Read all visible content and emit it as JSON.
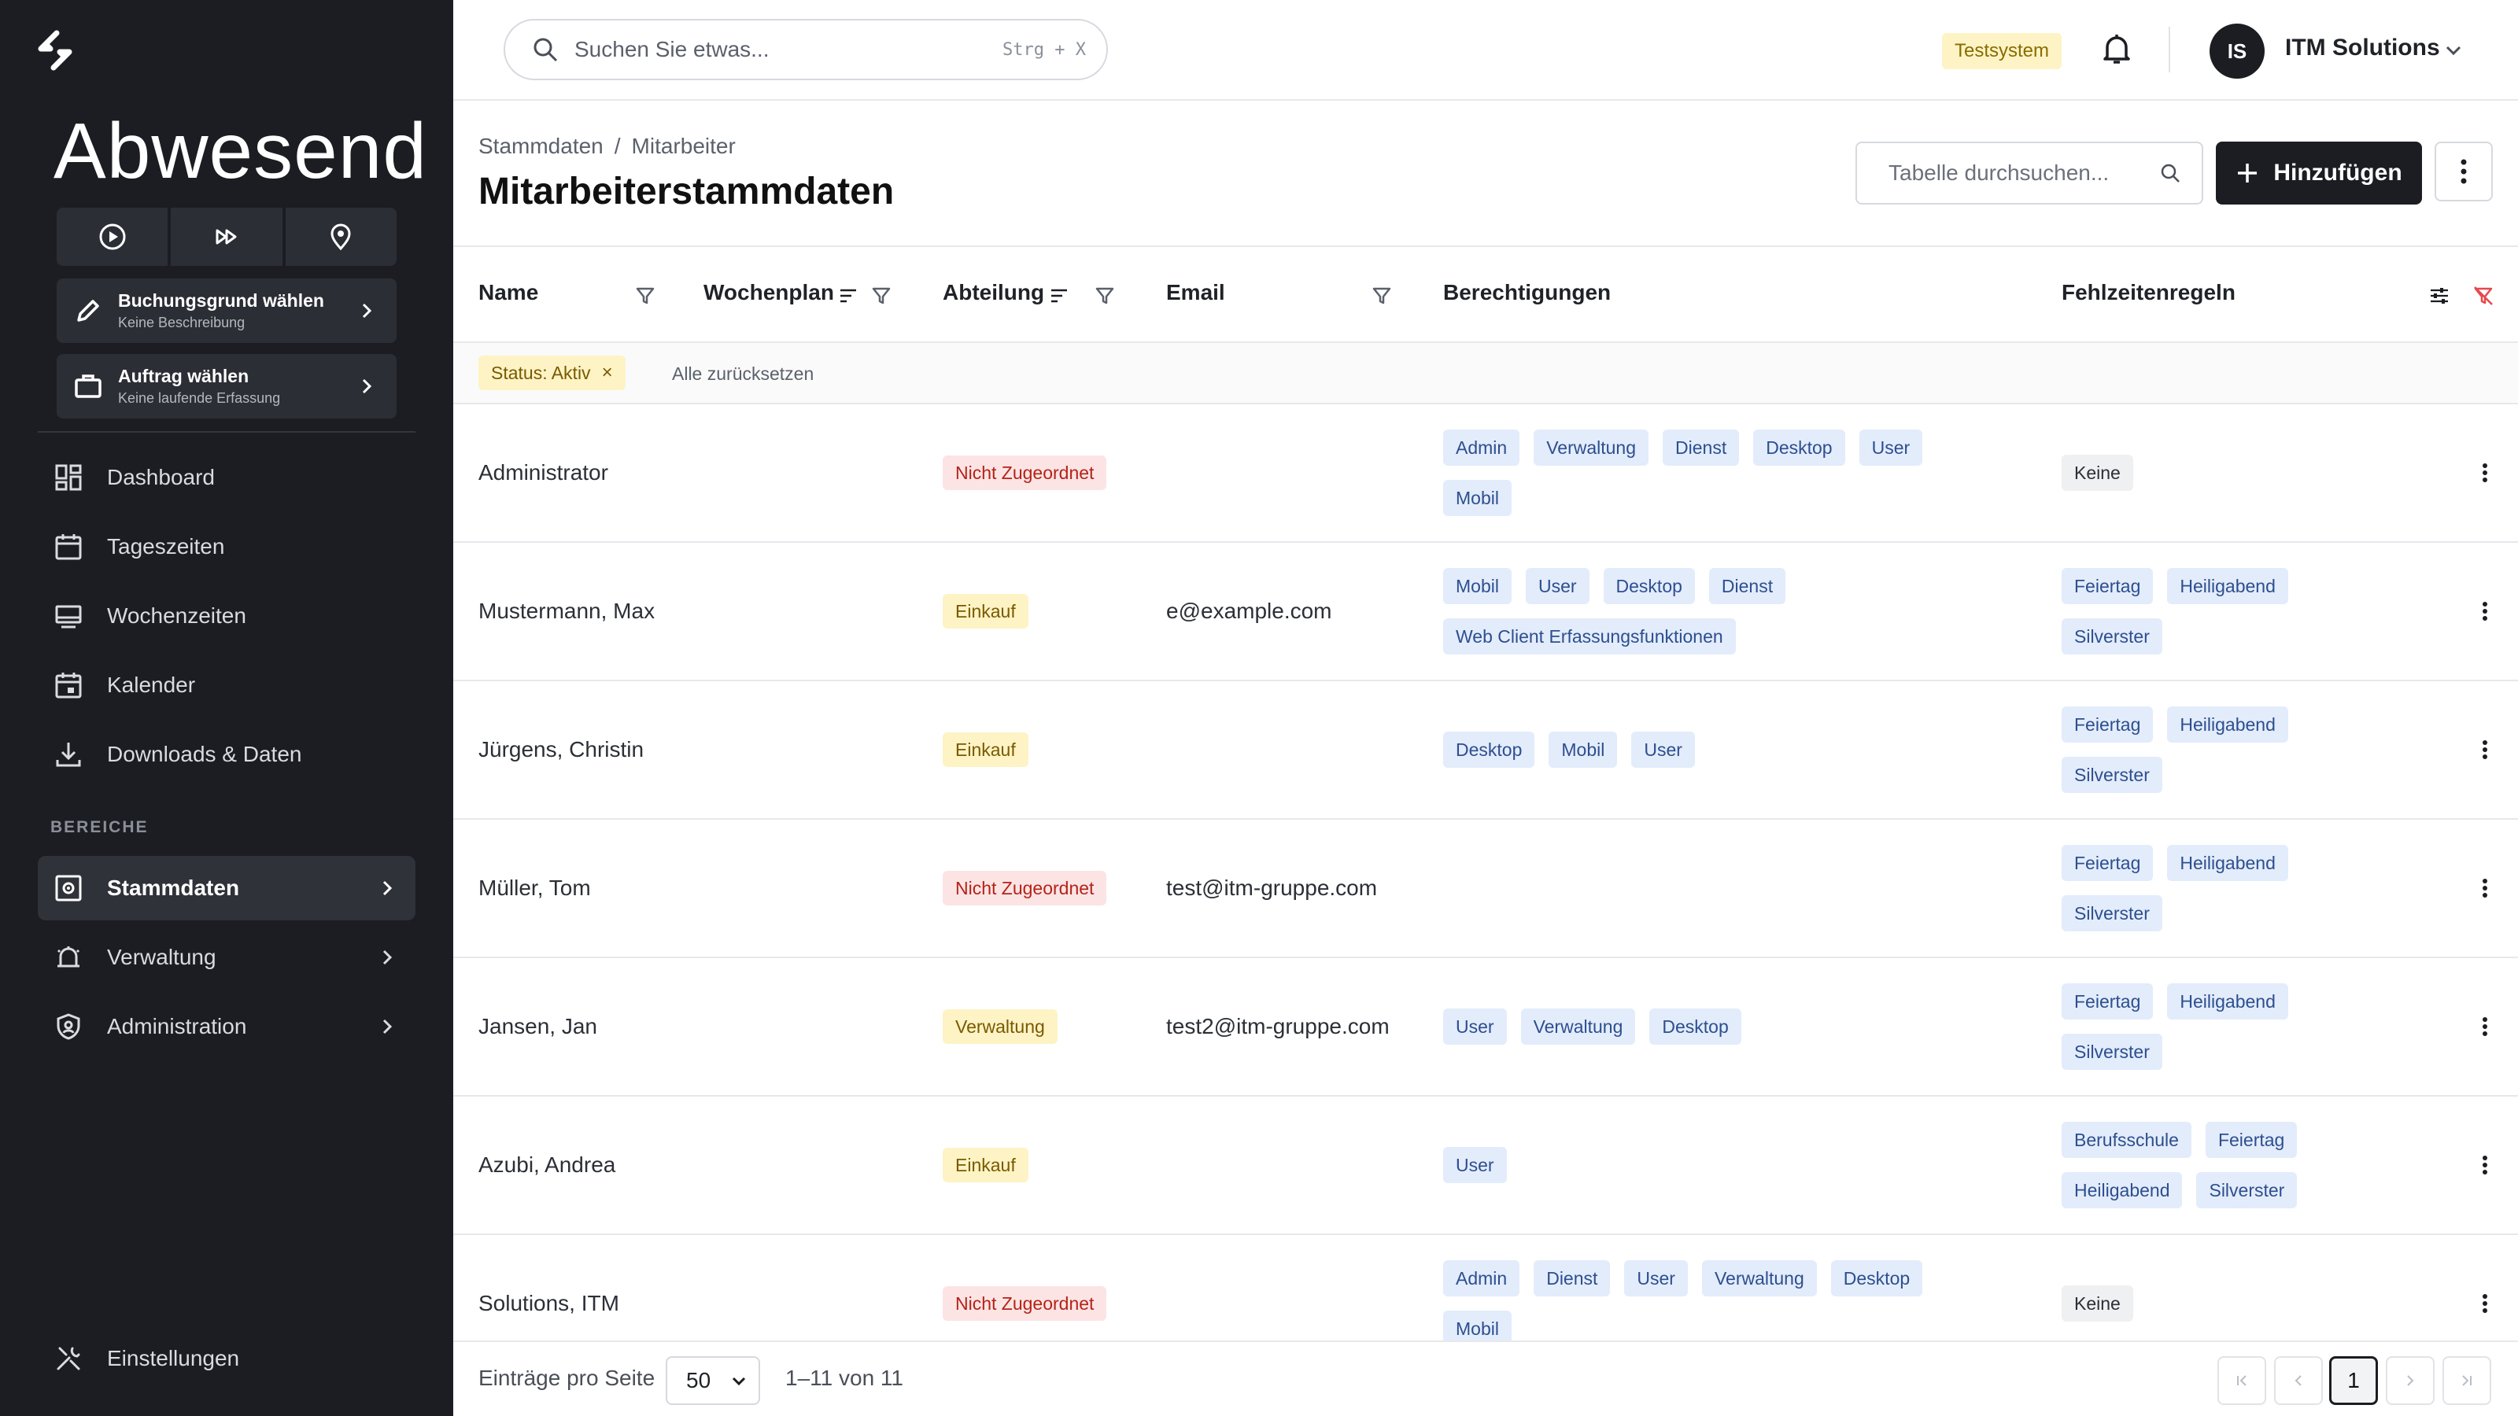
{
  "sidebar": {
    "status_title": "Abwesend",
    "controls": [
      {
        "icon": "play-circle-icon"
      },
      {
        "icon": "fast-forward-icon"
      },
      {
        "icon": "map-pin-icon"
      }
    ],
    "cards": [
      {
        "title": "Buchungsgrund wählen",
        "subtitle": "Keine Beschreibung",
        "icon": "pencil-icon"
      },
      {
        "title": "Auftrag wählen",
        "subtitle": "Keine laufende Erfassung",
        "icon": "briefcase-icon"
      }
    ],
    "nav": [
      {
        "label": "Dashboard",
        "icon": "dashboard-icon"
      },
      {
        "label": "Tageszeiten",
        "icon": "calendar-icon"
      },
      {
        "label": "Wochenzeiten",
        "icon": "monitor-icon"
      },
      {
        "label": "Kalender",
        "icon": "calendar-event-icon"
      },
      {
        "label": "Downloads & Daten",
        "icon": "download-icon"
      }
    ],
    "section_label": "BEREICHE",
    "areas": [
      {
        "label": "Stammdaten",
        "icon": "settings-box-icon",
        "active": true
      },
      {
        "label": "Verwaltung",
        "icon": "alarm-icon"
      },
      {
        "label": "Administration",
        "icon": "shield-user-icon"
      }
    ],
    "settings_label": "Einstellungen"
  },
  "topbar": {
    "search_placeholder": "Suchen Sie etwas...",
    "search_shortcut": "Strg + X",
    "env_badge": "Testsystem",
    "avatar_initials": "IS",
    "account_name": "ITM Solutions"
  },
  "page": {
    "breadcrumb": [
      "Stammdaten",
      "Mitarbeiter"
    ],
    "title": "Mitarbeiterstammdaten",
    "table_search_placeholder": "Tabelle durchsuchen...",
    "add_label": "Hinzufügen"
  },
  "table": {
    "columns": [
      "Name",
      "Wochenplan",
      "Abteilung",
      "Email",
      "Berechtigungen",
      "Fehlzeitenregeln"
    ],
    "active_filter": "Status: Aktiv",
    "reset_label": "Alle zurücksetzen",
    "rows": [
      {
        "name": "Administrator",
        "dept": "Nicht Zugeordnet",
        "dept_color": "#fde4e4",
        "email": "",
        "perms": [
          "Admin",
          "Verwaltung",
          "Dienst",
          "Desktop",
          "User",
          "Mobil"
        ],
        "rules": [
          "Keine"
        ]
      },
      {
        "name": "Mustermann, Max",
        "dept": "Einkauf",
        "dept_color": "#fdf3c4",
        "email": "e@example.com",
        "perms": [
          "Mobil",
          "User",
          "Desktop",
          "Dienst",
          "Web Client Erfassungsfunktionen"
        ],
        "rules": [
          "Feiertag",
          "Heiligabend",
          "Silverster"
        ]
      },
      {
        "name": "Jürgens, Christin",
        "dept": "Einkauf",
        "dept_color": "#fdf3c4",
        "email": "",
        "perms": [
          "Desktop",
          "Mobil",
          "User"
        ],
        "rules": [
          "Feiertag",
          "Heiligabend",
          "Silverster"
        ]
      },
      {
        "name": "Müller, Tom",
        "dept": "Nicht Zugeordnet",
        "dept_color": "#fde4e4",
        "email": "test@itm-gruppe.com",
        "perms": [],
        "rules": [
          "Feiertag",
          "Heiligabend",
          "Silverster"
        ]
      },
      {
        "name": "Jansen, Jan",
        "dept": "Verwaltung",
        "dept_color": "#fdf3c4",
        "email": "test2@itm-gruppe.com",
        "perms": [
          "User",
          "Verwaltung",
          "Desktop"
        ],
        "rules": [
          "Feiertag",
          "Heiligabend",
          "Silverster"
        ]
      },
      {
        "name": "Azubi, Andrea",
        "dept": "Einkauf",
        "dept_color": "#fdf3c4",
        "email": "",
        "perms": [
          "User"
        ],
        "rules": [
          "Berufsschule",
          "Feiertag",
          "Heiligabend",
          "Silverster"
        ]
      },
      {
        "name": "Solutions, ITM",
        "dept": "Nicht Zugeordnet",
        "dept_color": "#fde4e4",
        "email": "",
        "perms": [
          "Admin",
          "Dienst",
          "User",
          "Verwaltung",
          "Desktop",
          "Mobil"
        ],
        "rules": [
          "Keine"
        ]
      }
    ]
  },
  "footer": {
    "per_page_label": "Einträge pro Seite",
    "per_page_value": "50",
    "range_text": "1–11 von 11",
    "current_page": "1"
  }
}
